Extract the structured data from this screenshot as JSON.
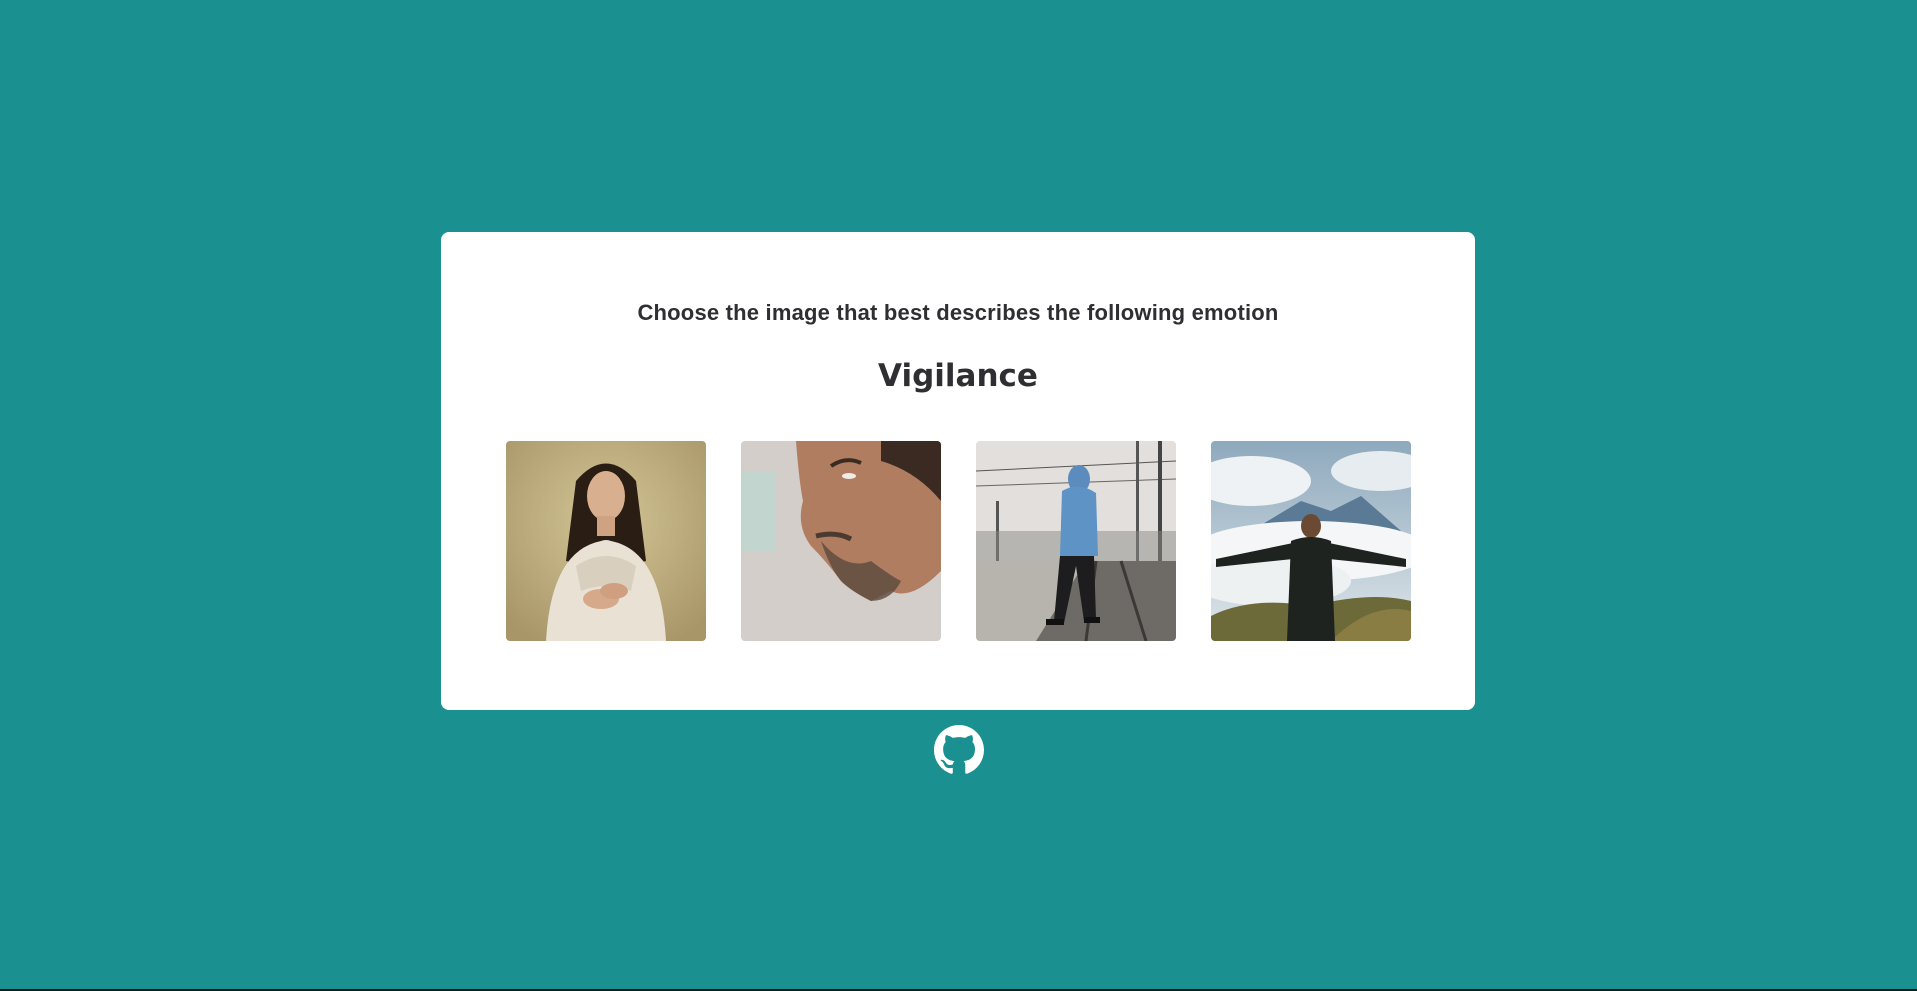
{
  "quiz": {
    "prompt": "Choose the image that best describes the following emotion",
    "emotion": "Vigilance",
    "options": [
      {
        "id": "option-1",
        "icon": "photo-woman-looking-up"
      },
      {
        "id": "option-2",
        "icon": "photo-man-profile"
      },
      {
        "id": "option-3",
        "icon": "photo-hooded-man-railway"
      },
      {
        "id": "option-4",
        "icon": "photo-man-arms-spread-clouds"
      }
    ]
  },
  "footer": {
    "icon": "github-icon"
  },
  "colors": {
    "background": "#1a9190",
    "card": "#ffffff",
    "text": "#2f2f33"
  }
}
